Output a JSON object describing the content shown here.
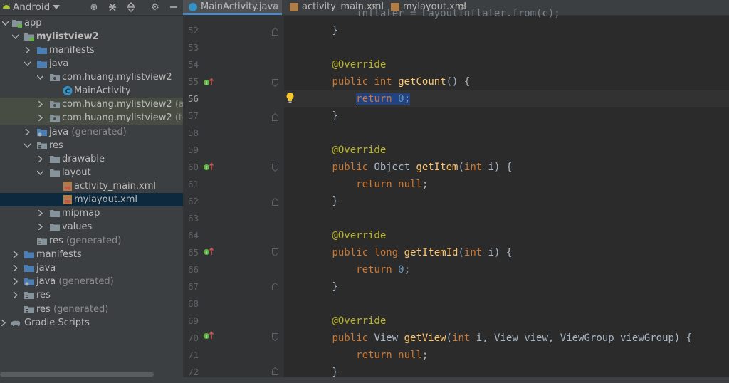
{
  "project_panel": {
    "view_name": "Android",
    "tree": [
      {
        "label": "app",
        "suffix": ""
      },
      {
        "label": "mylistview2",
        "suffix": ""
      },
      {
        "label": "manifests",
        "suffix": ""
      },
      {
        "label": "java",
        "suffix": ""
      },
      {
        "label": "com.huang.mylistview2",
        "suffix": ""
      },
      {
        "label": "MainActivity",
        "suffix": ""
      },
      {
        "label": "com.huang.mylistview2",
        "suffix": " (andro"
      },
      {
        "label": "com.huang.mylistview2",
        "suffix": " (test)"
      },
      {
        "label": "java",
        "suffix": " (generated)"
      },
      {
        "label": "res",
        "suffix": ""
      },
      {
        "label": "drawable",
        "suffix": ""
      },
      {
        "label": "layout",
        "suffix": ""
      },
      {
        "label": "activity_main.xml",
        "suffix": ""
      },
      {
        "label": "mylayout.xml",
        "suffix": ""
      },
      {
        "label": "mipmap",
        "suffix": ""
      },
      {
        "label": "values",
        "suffix": ""
      },
      {
        "label": "res",
        "suffix": " (generated)"
      },
      {
        "label": "manifests",
        "suffix": ""
      },
      {
        "label": "java",
        "suffix": ""
      },
      {
        "label": "java",
        "suffix": " (generated)"
      },
      {
        "label": "res",
        "suffix": ""
      },
      {
        "label": "res",
        "suffix": " (generated)"
      },
      {
        "label": "Gradle Scripts",
        "suffix": ""
      }
    ]
  },
  "tabs": [
    {
      "label": "MainActivity.java"
    },
    {
      "label": "activity_main.xml"
    },
    {
      "label": "mylayout.xml"
    }
  ],
  "editor": {
    "lines": [
      {
        "n": "52",
        "text": "        }"
      },
      {
        "n": "53",
        "text": ""
      },
      {
        "n": "54",
        "text": "        @Override"
      },
      {
        "n": "55",
        "text": "        public int getCount() {"
      },
      {
        "n": "56",
        "text": "            return 0;"
      },
      {
        "n": "57",
        "text": "        }"
      },
      {
        "n": "58",
        "text": ""
      },
      {
        "n": "59",
        "text": "        @Override"
      },
      {
        "n": "60",
        "text": "        public Object getItem(int i) {"
      },
      {
        "n": "61",
        "text": "            return null;"
      },
      {
        "n": "62",
        "text": "        }"
      },
      {
        "n": "63",
        "text": ""
      },
      {
        "n": "64",
        "text": "        @Override"
      },
      {
        "n": "65",
        "text": "        public long getItemId(int i) {"
      },
      {
        "n": "66",
        "text": "            return 0;"
      },
      {
        "n": "67",
        "text": "        }"
      },
      {
        "n": "68",
        "text": ""
      },
      {
        "n": "69",
        "text": "        @Override"
      },
      {
        "n": "70",
        "text": "        public View getView(int i, View view, ViewGroup viewGroup) {"
      },
      {
        "n": "71",
        "text": "            return null;"
      },
      {
        "n": "72",
        "text": "        }"
      }
    ],
    "partial_top_line": "            inflater = LayoutInflater.from(c);"
  },
  "colors": {
    "accent": "#4a88c7",
    "keyword": "#cc7832",
    "annotation": "#bbb529",
    "method": "#ffc66d",
    "number": "#6897bb",
    "selection": "#214283"
  },
  "icons": [
    "android-icon",
    "target-icon",
    "collapse-all-icon",
    "expand-all-icon",
    "gear-icon",
    "minimize-icon",
    "folder-icon",
    "package-icon",
    "class-icon",
    "xml-icon",
    "gradle-icon",
    "implements-icon",
    "bulb-icon"
  ]
}
